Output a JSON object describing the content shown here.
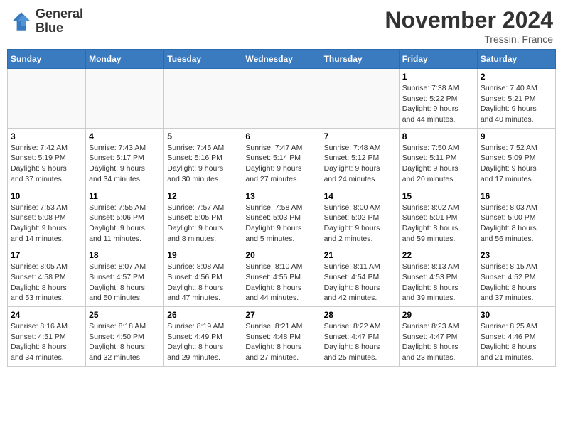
{
  "logo": {
    "line1": "General",
    "line2": "Blue"
  },
  "title": "November 2024",
  "location": "Tressin, France",
  "weekdays": [
    "Sunday",
    "Monday",
    "Tuesday",
    "Wednesday",
    "Thursday",
    "Friday",
    "Saturday"
  ],
  "weeks": [
    [
      {
        "day": "",
        "info": ""
      },
      {
        "day": "",
        "info": ""
      },
      {
        "day": "",
        "info": ""
      },
      {
        "day": "",
        "info": ""
      },
      {
        "day": "",
        "info": ""
      },
      {
        "day": "1",
        "info": "Sunrise: 7:38 AM\nSunset: 5:22 PM\nDaylight: 9 hours\nand 44 minutes."
      },
      {
        "day": "2",
        "info": "Sunrise: 7:40 AM\nSunset: 5:21 PM\nDaylight: 9 hours\nand 40 minutes."
      }
    ],
    [
      {
        "day": "3",
        "info": "Sunrise: 7:42 AM\nSunset: 5:19 PM\nDaylight: 9 hours\nand 37 minutes."
      },
      {
        "day": "4",
        "info": "Sunrise: 7:43 AM\nSunset: 5:17 PM\nDaylight: 9 hours\nand 34 minutes."
      },
      {
        "day": "5",
        "info": "Sunrise: 7:45 AM\nSunset: 5:16 PM\nDaylight: 9 hours\nand 30 minutes."
      },
      {
        "day": "6",
        "info": "Sunrise: 7:47 AM\nSunset: 5:14 PM\nDaylight: 9 hours\nand 27 minutes."
      },
      {
        "day": "7",
        "info": "Sunrise: 7:48 AM\nSunset: 5:12 PM\nDaylight: 9 hours\nand 24 minutes."
      },
      {
        "day": "8",
        "info": "Sunrise: 7:50 AM\nSunset: 5:11 PM\nDaylight: 9 hours\nand 20 minutes."
      },
      {
        "day": "9",
        "info": "Sunrise: 7:52 AM\nSunset: 5:09 PM\nDaylight: 9 hours\nand 17 minutes."
      }
    ],
    [
      {
        "day": "10",
        "info": "Sunrise: 7:53 AM\nSunset: 5:08 PM\nDaylight: 9 hours\nand 14 minutes."
      },
      {
        "day": "11",
        "info": "Sunrise: 7:55 AM\nSunset: 5:06 PM\nDaylight: 9 hours\nand 11 minutes."
      },
      {
        "day": "12",
        "info": "Sunrise: 7:57 AM\nSunset: 5:05 PM\nDaylight: 9 hours\nand 8 minutes."
      },
      {
        "day": "13",
        "info": "Sunrise: 7:58 AM\nSunset: 5:03 PM\nDaylight: 9 hours\nand 5 minutes."
      },
      {
        "day": "14",
        "info": "Sunrise: 8:00 AM\nSunset: 5:02 PM\nDaylight: 9 hours\nand 2 minutes."
      },
      {
        "day": "15",
        "info": "Sunrise: 8:02 AM\nSunset: 5:01 PM\nDaylight: 8 hours\nand 59 minutes."
      },
      {
        "day": "16",
        "info": "Sunrise: 8:03 AM\nSunset: 5:00 PM\nDaylight: 8 hours\nand 56 minutes."
      }
    ],
    [
      {
        "day": "17",
        "info": "Sunrise: 8:05 AM\nSunset: 4:58 PM\nDaylight: 8 hours\nand 53 minutes."
      },
      {
        "day": "18",
        "info": "Sunrise: 8:07 AM\nSunset: 4:57 PM\nDaylight: 8 hours\nand 50 minutes."
      },
      {
        "day": "19",
        "info": "Sunrise: 8:08 AM\nSunset: 4:56 PM\nDaylight: 8 hours\nand 47 minutes."
      },
      {
        "day": "20",
        "info": "Sunrise: 8:10 AM\nSunset: 4:55 PM\nDaylight: 8 hours\nand 44 minutes."
      },
      {
        "day": "21",
        "info": "Sunrise: 8:11 AM\nSunset: 4:54 PM\nDaylight: 8 hours\nand 42 minutes."
      },
      {
        "day": "22",
        "info": "Sunrise: 8:13 AM\nSunset: 4:53 PM\nDaylight: 8 hours\nand 39 minutes."
      },
      {
        "day": "23",
        "info": "Sunrise: 8:15 AM\nSunset: 4:52 PM\nDaylight: 8 hours\nand 37 minutes."
      }
    ],
    [
      {
        "day": "24",
        "info": "Sunrise: 8:16 AM\nSunset: 4:51 PM\nDaylight: 8 hours\nand 34 minutes."
      },
      {
        "day": "25",
        "info": "Sunrise: 8:18 AM\nSunset: 4:50 PM\nDaylight: 8 hours\nand 32 minutes."
      },
      {
        "day": "26",
        "info": "Sunrise: 8:19 AM\nSunset: 4:49 PM\nDaylight: 8 hours\nand 29 minutes."
      },
      {
        "day": "27",
        "info": "Sunrise: 8:21 AM\nSunset: 4:48 PM\nDaylight: 8 hours\nand 27 minutes."
      },
      {
        "day": "28",
        "info": "Sunrise: 8:22 AM\nSunset: 4:47 PM\nDaylight: 8 hours\nand 25 minutes."
      },
      {
        "day": "29",
        "info": "Sunrise: 8:23 AM\nSunset: 4:47 PM\nDaylight: 8 hours\nand 23 minutes."
      },
      {
        "day": "30",
        "info": "Sunrise: 8:25 AM\nSunset: 4:46 PM\nDaylight: 8 hours\nand 21 minutes."
      }
    ]
  ]
}
